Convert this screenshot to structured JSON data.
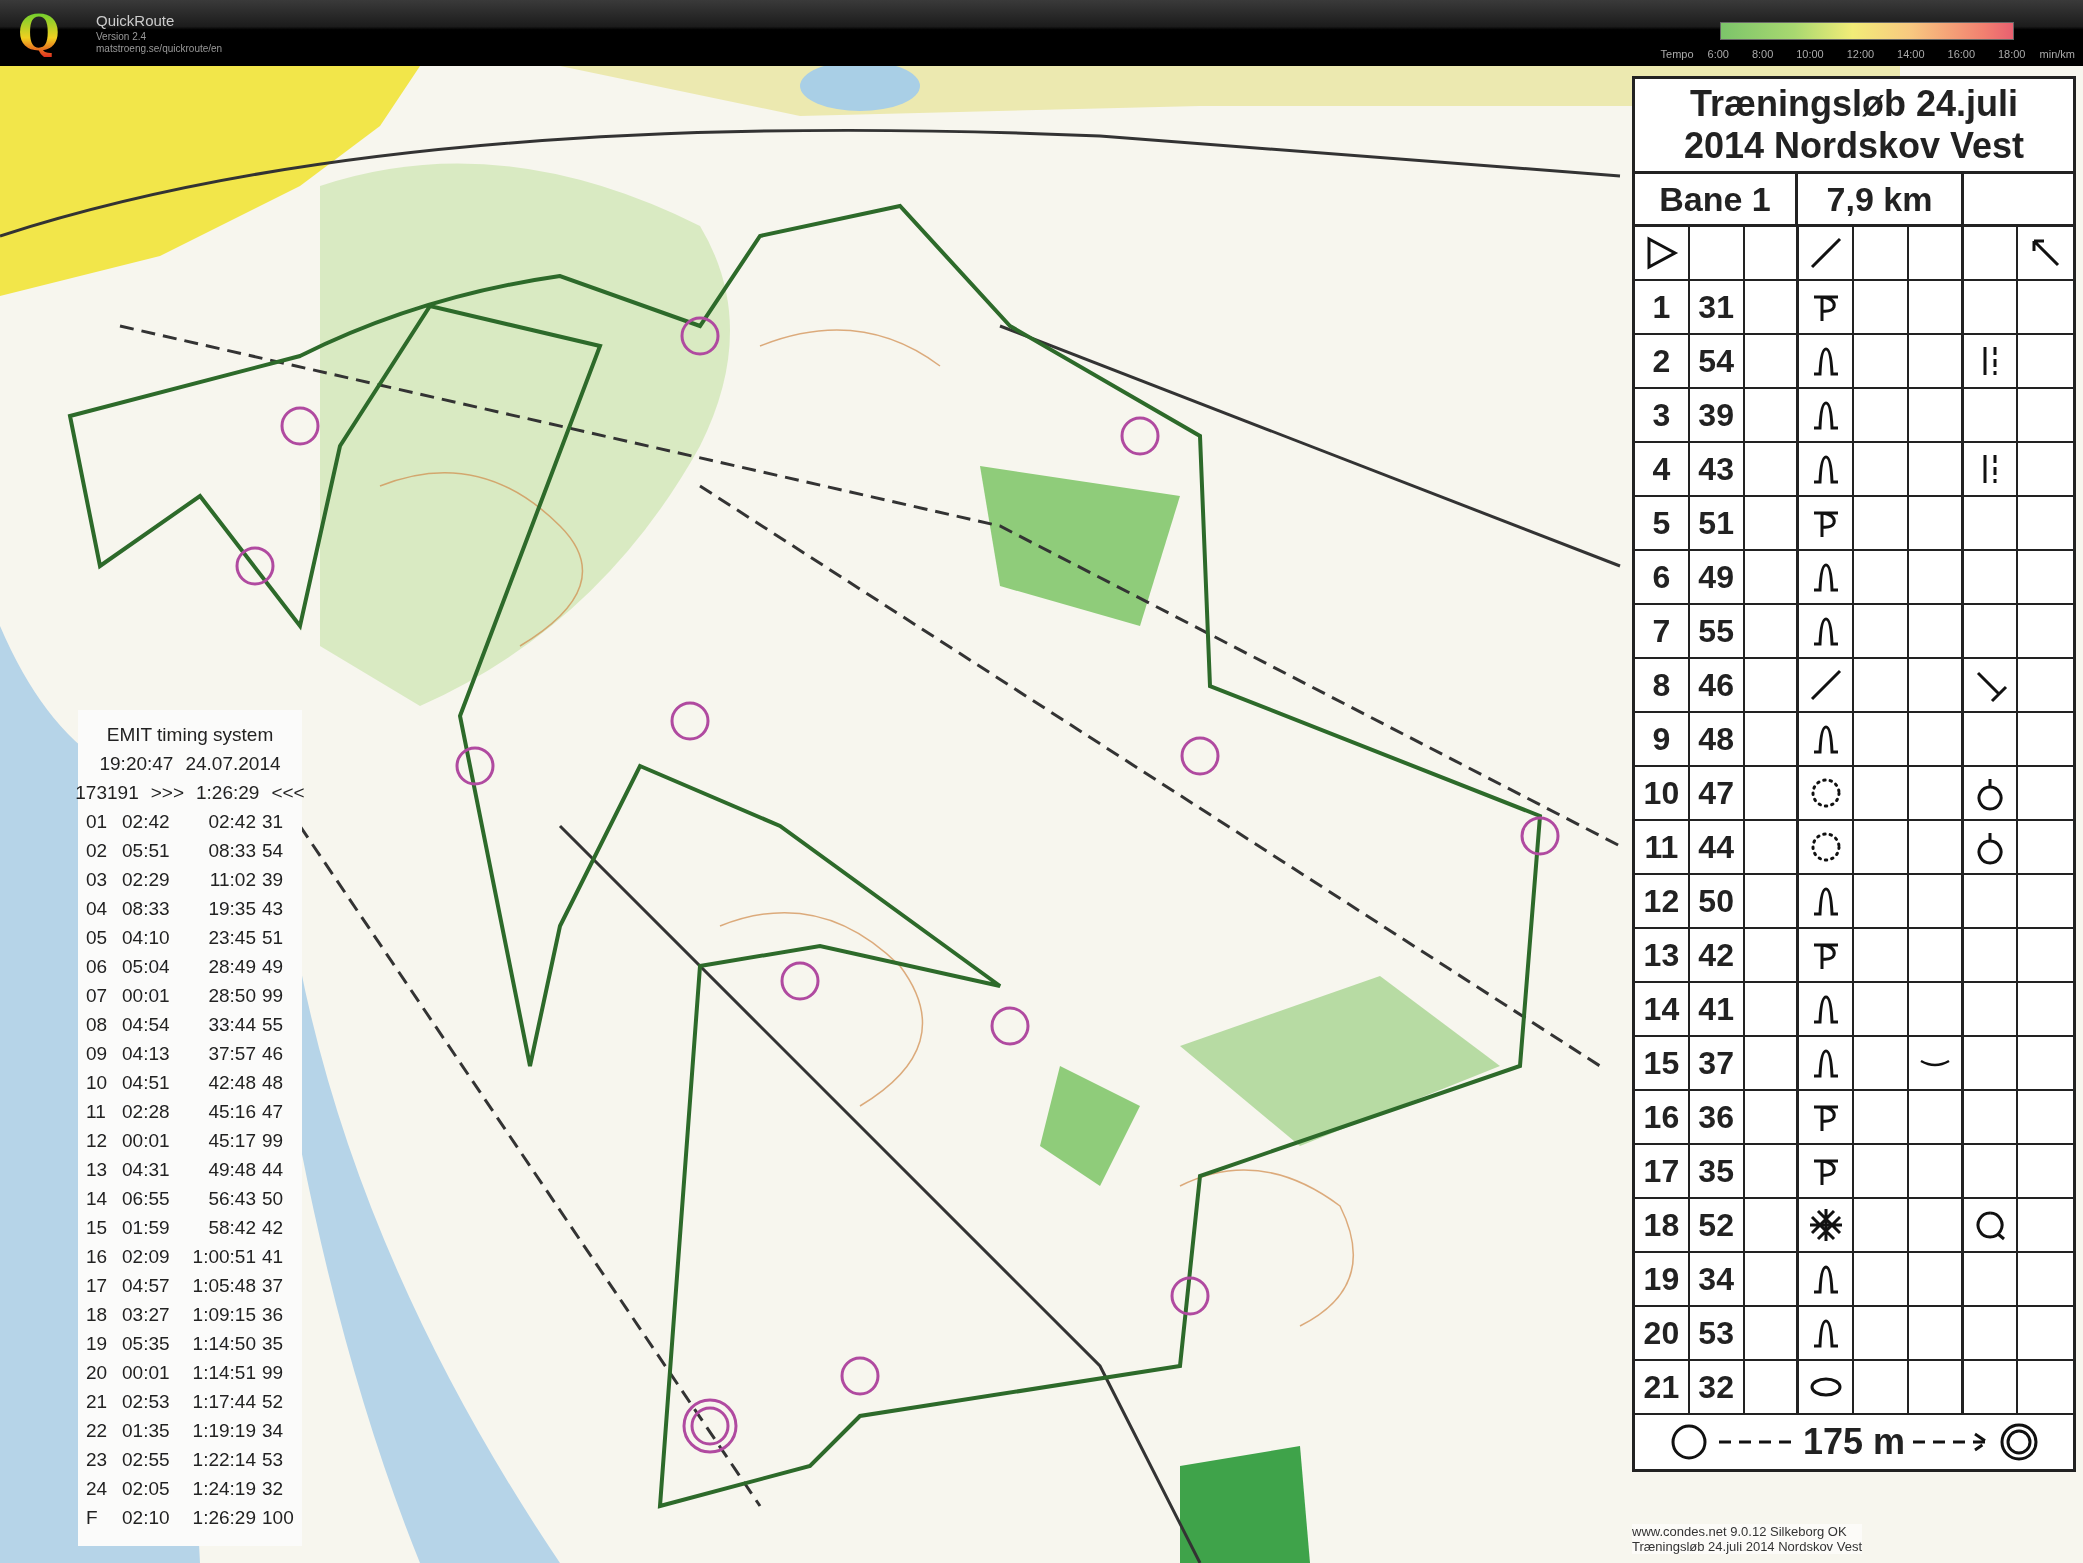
{
  "app": {
    "logo_letter": "Q",
    "name": "QuickRoute",
    "version": "Version 2.4",
    "url": "matstroeng.se/quickroute/en"
  },
  "tempo": {
    "label": "Tempo",
    "ticks": [
      "6:00",
      "8:00",
      "10:00",
      "12:00",
      "14:00",
      "16:00",
      "18:00"
    ],
    "unit": "min/km"
  },
  "receipt": {
    "title": "EMIT timing system",
    "time": "19:20:47",
    "date": "24.07.2014",
    "card": "173191",
    "open_mark": ">>>",
    "total": "1:26:29",
    "close_mark": "<<<",
    "rows": [
      {
        "leg": "01",
        "split": "02:42",
        "elapsed": "02:42",
        "code": "31"
      },
      {
        "leg": "02",
        "split": "05:51",
        "elapsed": "08:33",
        "code": "54"
      },
      {
        "leg": "03",
        "split": "02:29",
        "elapsed": "11:02",
        "code": "39"
      },
      {
        "leg": "04",
        "split": "08:33",
        "elapsed": "19:35",
        "code": "43"
      },
      {
        "leg": "05",
        "split": "04:10",
        "elapsed": "23:45",
        "code": "51"
      },
      {
        "leg": "06",
        "split": "05:04",
        "elapsed": "28:49",
        "code": "49"
      },
      {
        "leg": "07",
        "split": "00:01",
        "elapsed": "28:50",
        "code": "99"
      },
      {
        "leg": "08",
        "split": "04:54",
        "elapsed": "33:44",
        "code": "55"
      },
      {
        "leg": "09",
        "split": "04:13",
        "elapsed": "37:57",
        "code": "46"
      },
      {
        "leg": "10",
        "split": "04:51",
        "elapsed": "42:48",
        "code": "48"
      },
      {
        "leg": "11",
        "split": "02:28",
        "elapsed": "45:16",
        "code": "47"
      },
      {
        "leg": "12",
        "split": "00:01",
        "elapsed": "45:17",
        "code": "99"
      },
      {
        "leg": "13",
        "split": "04:31",
        "elapsed": "49:48",
        "code": "44"
      },
      {
        "leg": "14",
        "split": "06:55",
        "elapsed": "56:43",
        "code": "50"
      },
      {
        "leg": "15",
        "split": "01:59",
        "elapsed": "58:42",
        "code": "42"
      },
      {
        "leg": "16",
        "split": "02:09",
        "elapsed": "1:00:51",
        "code": "41"
      },
      {
        "leg": "17",
        "split": "04:57",
        "elapsed": "1:05:48",
        "code": "37"
      },
      {
        "leg": "18",
        "split": "03:27",
        "elapsed": "1:09:15",
        "code": "36"
      },
      {
        "leg": "19",
        "split": "05:35",
        "elapsed": "1:14:50",
        "code": "35"
      },
      {
        "leg": "20",
        "split": "00:01",
        "elapsed": "1:14:51",
        "code": "99"
      },
      {
        "leg": "21",
        "split": "02:53",
        "elapsed": "1:17:44",
        "code": "52"
      },
      {
        "leg": "22",
        "split": "01:35",
        "elapsed": "1:19:19",
        "code": "34"
      },
      {
        "leg": "23",
        "split": "02:55",
        "elapsed": "1:22:14",
        "code": "53"
      },
      {
        "leg": "24",
        "split": "02:05",
        "elapsed": "1:24:19",
        "code": "32"
      },
      {
        "leg": "F",
        "split": "02:10",
        "elapsed": "1:26:29",
        "code": "100"
      }
    ]
  },
  "description": {
    "title_lines": [
      "Træningsløb 24.juli",
      "2014 Nordskov Vest"
    ],
    "course": "Bane 1",
    "length": "7,9 km",
    "controls": [
      {
        "number": "1",
        "code": "31",
        "feature": {
          "kind": "spur"
        }
      },
      {
        "number": "2",
        "code": "54",
        "feature": {
          "kind": "knoll"
        },
        "detail": {
          "kind": "fence"
        }
      },
      {
        "number": "3",
        "code": "39",
        "feature": {
          "kind": "knoll"
        }
      },
      {
        "number": "4",
        "code": "43",
        "feature": {
          "kind": "knoll"
        },
        "detail": {
          "kind": "fence"
        }
      },
      {
        "number": "5",
        "code": "51",
        "feature": {
          "kind": "spur"
        }
      },
      {
        "number": "6",
        "code": "49",
        "feature": {
          "kind": "knoll"
        }
      },
      {
        "number": "7",
        "code": "55",
        "feature": {
          "kind": "knoll"
        }
      },
      {
        "number": "8",
        "code": "46",
        "feature": {
          "kind": "line"
        },
        "detail": {
          "kind": "pole"
        }
      },
      {
        "number": "9",
        "code": "48",
        "feature": {
          "kind": "knoll"
        }
      },
      {
        "number": "10",
        "code": "47",
        "feature": {
          "kind": "dotted"
        },
        "detail": {
          "kind": "ring"
        }
      },
      {
        "number": "11",
        "code": "44",
        "feature": {
          "kind": "dotted"
        },
        "detail": {
          "kind": "ring"
        }
      },
      {
        "number": "12",
        "code": "50",
        "feature": {
          "kind": "knoll"
        }
      },
      {
        "number": "13",
        "code": "42",
        "feature": {
          "kind": "spur"
        }
      },
      {
        "number": "14",
        "code": "41",
        "feature": {
          "kind": "knoll"
        }
      },
      {
        "number": "15",
        "code": "37",
        "feature": {
          "kind": "knoll"
        },
        "appearance": {
          "kind": "bend"
        }
      },
      {
        "number": "16",
        "code": "36",
        "feature": {
          "kind": "spur"
        }
      },
      {
        "number": "17",
        "code": "35",
        "feature": {
          "kind": "spur"
        }
      },
      {
        "number": "18",
        "code": "52",
        "feature": {
          "kind": "hatch"
        },
        "detail": {
          "kind": "circle"
        }
      },
      {
        "number": "19",
        "code": "34",
        "feature": {
          "kind": "knoll"
        }
      },
      {
        "number": "20",
        "code": "53",
        "feature": {
          "kind": "knoll"
        }
      },
      {
        "number": "21",
        "code": "32",
        "feature": {
          "kind": "ellipse"
        }
      }
    ],
    "finish_distance": "175 m",
    "footer_lines": [
      "www.condes.net 9.0.12 Silkeborg OK",
      "Træningsløb 24.juli 2014 Nordskov Vest"
    ]
  }
}
